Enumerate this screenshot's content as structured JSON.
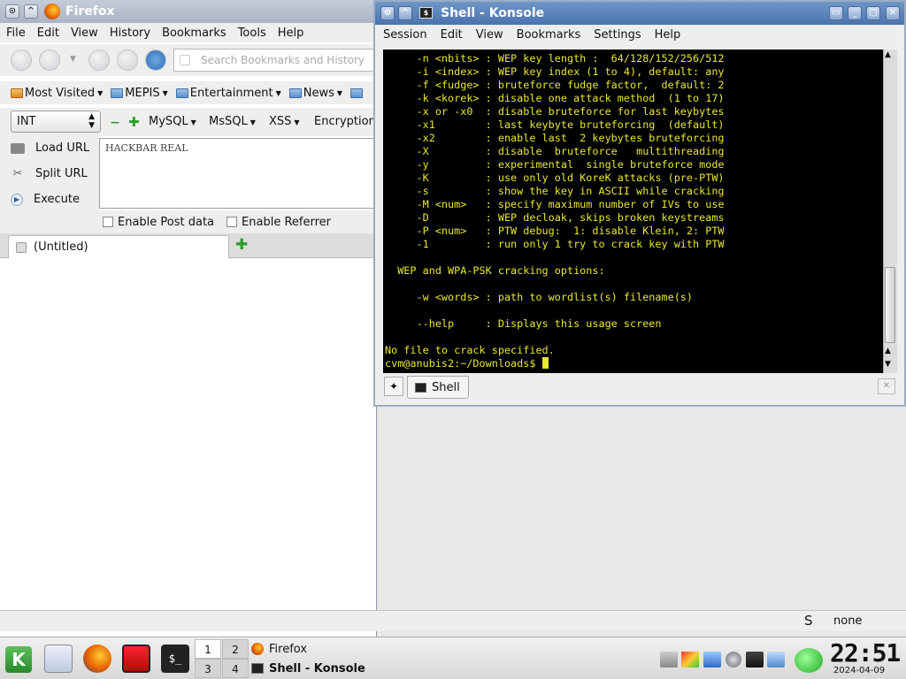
{
  "firefox": {
    "title": "Firefox",
    "menu": [
      "File",
      "Edit",
      "View",
      "History",
      "Bookmarks",
      "Tools",
      "Help"
    ],
    "search_placeholder": "Search Bookmarks and History",
    "bookmarks": [
      "Most Visited",
      "MEPIS",
      "Entertainment",
      "News"
    ],
    "hackbar": {
      "encoding_select": "INT",
      "menus": [
        "MySQL",
        "MsSQL",
        "XSS",
        "Encryption"
      ],
      "load_url": "Load URL",
      "split_url": "Split URL",
      "execute": "Execute",
      "textarea_value": "HACKBAR REAL",
      "enable_post": "Enable Post data",
      "enable_referrer": "Enable Referrer"
    },
    "tab_title": "(Untitled)",
    "status_right": "none"
  },
  "konsole": {
    "title": "Shell - Konsole",
    "menu": [
      "Session",
      "Edit",
      "View",
      "Bookmarks",
      "Settings",
      "Help"
    ],
    "terminal_lines": [
      "     -n <nbits> : WEP key length :  64/128/152/256/512",
      "     -i <index> : WEP key index (1 to 4), default: any",
      "     -f <fudge> : bruteforce fudge factor,  default: 2",
      "     -k <korek> : disable one attack method  (1 to 17)",
      "     -x or -x0  : disable bruteforce for last keybytes",
      "     -x1        : last keybyte bruteforcing  (default)",
      "     -x2        : enable last  2 keybytes bruteforcing",
      "     -X         : disable  bruteforce   multithreading",
      "     -y         : experimental  single bruteforce mode",
      "     -K         : use only old KoreK attacks (pre-PTW)",
      "     -s         : show the key in ASCII while cracking",
      "     -M <num>   : specify maximum number of IVs to use",
      "     -D         : WEP decloak, skips broken keystreams",
      "     -P <num>   : PTW debug:  1: disable Klein, 2: PTW",
      "     -1         : run only 1 try to crack key with PTW",
      "",
      "  WEP and WPA-PSK cracking options:",
      "",
      "     -w <words> : path to wordlist(s) filename(s)",
      "",
      "     --help     : Displays this usage screen",
      "",
      "No file to crack specified."
    ],
    "prompt": "cvm@anubis2:~/Downloads$ ",
    "tab_label": "Shell"
  },
  "taskbar": {
    "pager": [
      "1",
      "2",
      "3",
      "4"
    ],
    "tasks": [
      "Firefox",
      "Shell - Konsole"
    ],
    "clock": "22:51",
    "date": "2024-04-09"
  },
  "colors": {
    "terminal_bg": "#000000",
    "terminal_fg": "#e8e830",
    "konsole_title": "#4a74ad"
  }
}
